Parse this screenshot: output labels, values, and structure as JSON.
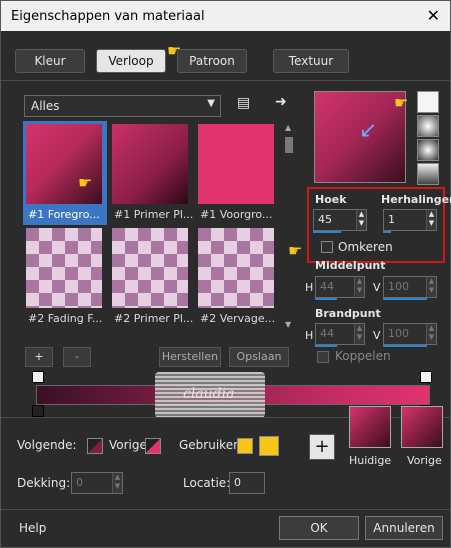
{
  "window": {
    "title": "Eigenschappen van materiaal",
    "close_glyph": "✕"
  },
  "tabs": [
    {
      "label": "Kleur"
    },
    {
      "label": "Verloop"
    },
    {
      "label": "Patroon"
    },
    {
      "label": "Textuur"
    }
  ],
  "category": {
    "selected": "Alles"
  },
  "thumbnails": [
    {
      "caption": "#1 Foregro..."
    },
    {
      "caption": "#1 Primer Pl..."
    },
    {
      "caption": "#1 Voorgro..."
    },
    {
      "caption": "#2 Fading F..."
    },
    {
      "caption": "#2 Primer Pl..."
    },
    {
      "caption": "#2 Vervage..."
    }
  ],
  "list_buttons": {
    "add": "+",
    "remove": "-",
    "restore": "Herstellen",
    "save": "Opslaan"
  },
  "settings": {
    "angle_label": "Hoek",
    "angle_value": "45",
    "repeats_label": "Herhalingen",
    "repeats_value": "1",
    "invert_label": "Omkeren",
    "midpoint_label": "Middelpunt",
    "mid_h_label": "H",
    "mid_h_value": "44",
    "mid_v_label": "V",
    "mid_v_value": "100",
    "focal_label": "Brandpunt",
    "focal_h_label": "H",
    "focal_h_value": "44",
    "focal_v_label": "V",
    "focal_v_value": "100",
    "link_label": "Koppelen"
  },
  "watermark": {
    "text": "claudia"
  },
  "bottom": {
    "next_label": "Volgende:",
    "prev_label": "Vorige:",
    "user_label": "Gebruiker:",
    "opacity_label": "Dekking:",
    "opacity_value": "0",
    "location_label": "Locatie:",
    "location_value": "0",
    "current_label": "Huidige",
    "previous_label": "Vorige",
    "add_button": "+"
  },
  "footer": {
    "help": "Help",
    "ok": "OK",
    "cancel": "Annuleren"
  },
  "colors": {
    "accent": "#e0336f",
    "selection": "#3a76c4",
    "highlight_box": "#d01818",
    "user_swatch": "#f5c518"
  }
}
